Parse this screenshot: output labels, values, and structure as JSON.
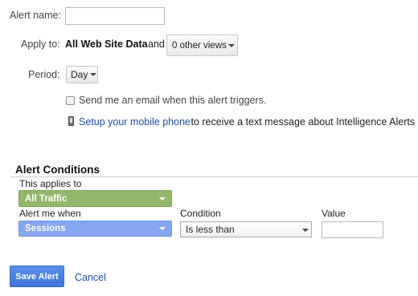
{
  "alert_name": {
    "label": "Alert name:",
    "value": "",
    "placeholder": ""
  },
  "apply_to": {
    "label": "Apply to:",
    "scope": "All Web Site Data",
    "conjunction": "and",
    "views_dropdown": "0 other views"
  },
  "period": {
    "label": "Period:",
    "value": "Day"
  },
  "email_option": {
    "label": "Send me an email when this alert triggers.",
    "checked": false
  },
  "mobile_option": {
    "link": "Setup your mobile phone",
    "rest": " to receive a text message about Intelligence Alerts"
  },
  "conditions": {
    "title": "Alert Conditions",
    "applies_to_label": "This applies to",
    "applies_to_value": "All Traffic",
    "alert_when_label": "Alert me when",
    "alert_when_value": "Sessions",
    "condition_label": "Condition",
    "condition_value": "Is less than",
    "value_label": "Value",
    "value_input": ""
  },
  "actions": {
    "save": "Save Alert",
    "cancel": "Cancel"
  },
  "colors": {
    "traffic_pill": "#92b96b",
    "sessions_pill": "#86a7f0",
    "save_button": "#4a82e0",
    "link": "#1a4fa0"
  }
}
